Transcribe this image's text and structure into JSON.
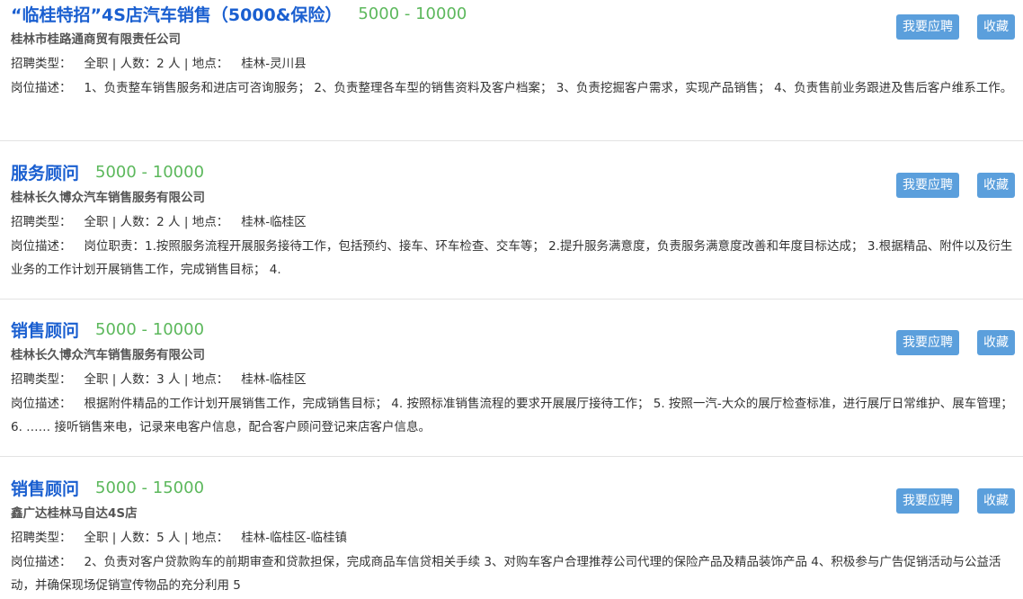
{
  "labels": {
    "recruit_type": "招聘类型：",
    "headcount": "人数：",
    "location": "地点：",
    "description": "岗位描述：",
    "separator": "|"
  },
  "buttons": {
    "apply": "我要应聘",
    "favorite": "收藏"
  },
  "jobs": [
    {
      "title": "“临桂特招”4S店汽车销售（5000&保险）",
      "salary": "5000 - 10000",
      "company": "桂林市桂路通商贸有限责任公司",
      "type": "全职",
      "count": "2 人",
      "location": "桂林-灵川县",
      "description": "1、负责整车销售服务和进店可咨询服务； 2、负责整理各车型的销售资料及客户档案； 3、负责挖掘客户需求，实现产品销售； 4、负责售前业务跟进及售后客户维系工作。"
    },
    {
      "title": "服务顾问",
      "salary": "5000 - 10000",
      "company": "桂林长久博众汽车销售服务有限公司",
      "type": "全职",
      "count": "2 人",
      "location": "桂林-临桂区",
      "description": "岗位职责：1.按照服务流程开展服务接待工作，包括预约、接车、环车检查、交车等； 2.提升服务满意度，负责服务满意度改善和年度目标达成； 3.根据精品、附件以及衍生业务的工作计划开展销售工作，完成销售目标； 4."
    },
    {
      "title": "销售顾问",
      "salary": "5000 - 10000",
      "company": "桂林长久博众汽车销售服务有限公司",
      "type": "全职",
      "count": "3 人",
      "location": "桂林-临桂区",
      "description": "根据附件精品的工作计划开展销售工作，完成销售目标； 4. 按照标准销售流程的要求开展展厅接待工作； 5. 按照一汽-大众的展厅检查标准，进行展厅日常维护、展车管理； 6. …… 接听销售来电，记录来电客户信息，配合客户顾问登记来店客户信息。"
    },
    {
      "title": "销售顾问",
      "salary": "5000 - 15000",
      "company": "鑫广达桂林马自达4S店",
      "type": "全职",
      "count": "5 人",
      "location": "桂林-临桂区-临桂镇",
      "description": "2、负责对客户贷款购车的前期审查和贷款担保，完成商品车信贷相关手续 3、对购车客户合理推荐公司代理的保险产品及精品装饰产品 4、积极参与广告促销活动与公益活动，并确保现场促销宣传物品的充分利用 5"
    }
  ]
}
